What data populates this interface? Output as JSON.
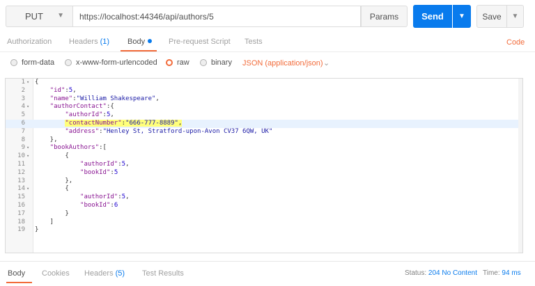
{
  "request": {
    "method": "PUT",
    "url": "https://localhost:44346/api/authors/5",
    "params_label": "Params",
    "send_label": "Send",
    "save_label": "Save"
  },
  "request_tabs": [
    {
      "label": "Authorization",
      "count": ""
    },
    {
      "label": "Headers",
      "count": "(1)"
    },
    {
      "label": "Body",
      "count": ""
    },
    {
      "label": "Pre-request Script",
      "count": ""
    },
    {
      "label": "Tests",
      "count": ""
    }
  ],
  "code_link": "Code",
  "body_options": {
    "form_data": "form-data",
    "urlencoded": "x-www-form-urlencoded",
    "raw": "raw",
    "binary": "binary",
    "selected": "raw",
    "content_type": "JSON (application/json)"
  },
  "editor": {
    "highlighted_line": 6,
    "lines": [
      {
        "n": "1",
        "fold": "▾"
      },
      {
        "n": "2"
      },
      {
        "n": "3"
      },
      {
        "n": "4",
        "fold": "▾"
      },
      {
        "n": "5"
      },
      {
        "n": "6"
      },
      {
        "n": "7"
      },
      {
        "n": "8"
      },
      {
        "n": "9",
        "fold": "▾"
      },
      {
        "n": "10",
        "fold": "▾"
      },
      {
        "n": "11"
      },
      {
        "n": "12"
      },
      {
        "n": "13"
      },
      {
        "n": "14",
        "fold": "▾"
      },
      {
        "n": "15"
      },
      {
        "n": "16"
      },
      {
        "n": "17"
      },
      {
        "n": "18"
      },
      {
        "n": "19"
      }
    ],
    "json": {
      "id_key": "\"id\"",
      "id_val": "5",
      "name_key": "\"name\"",
      "name_val": "\"William Shakespeare\"",
      "contact_key": "\"authorContact\"",
      "author_id_key": "\"authorId\"",
      "author_id_val": "5",
      "contact_number_key": "\"contactNumber\"",
      "contact_number_val": "\"666-777-8889\"",
      "address_key": "\"address\"",
      "address_val": "\"Henley St, Stratford-upon-Avon CV37 6QW, UK\"",
      "book_authors_key": "\"bookAuthors\"",
      "book1_author_id_val": "5",
      "book_id_key": "\"bookId\"",
      "book1_book_id_val": "5",
      "book2_author_id_val": "5",
      "book2_book_id_val": "6"
    }
  },
  "response_tabs": [
    {
      "label": "Body",
      "count": ""
    },
    {
      "label": "Cookies",
      "count": ""
    },
    {
      "label": "Headers",
      "count": "(5)"
    },
    {
      "label": "Test Results",
      "count": ""
    }
  ],
  "response_status": {
    "status_label": "Status:",
    "status_value": "204 No Content",
    "time_label": "Time:",
    "time_value": "94 ms"
  }
}
